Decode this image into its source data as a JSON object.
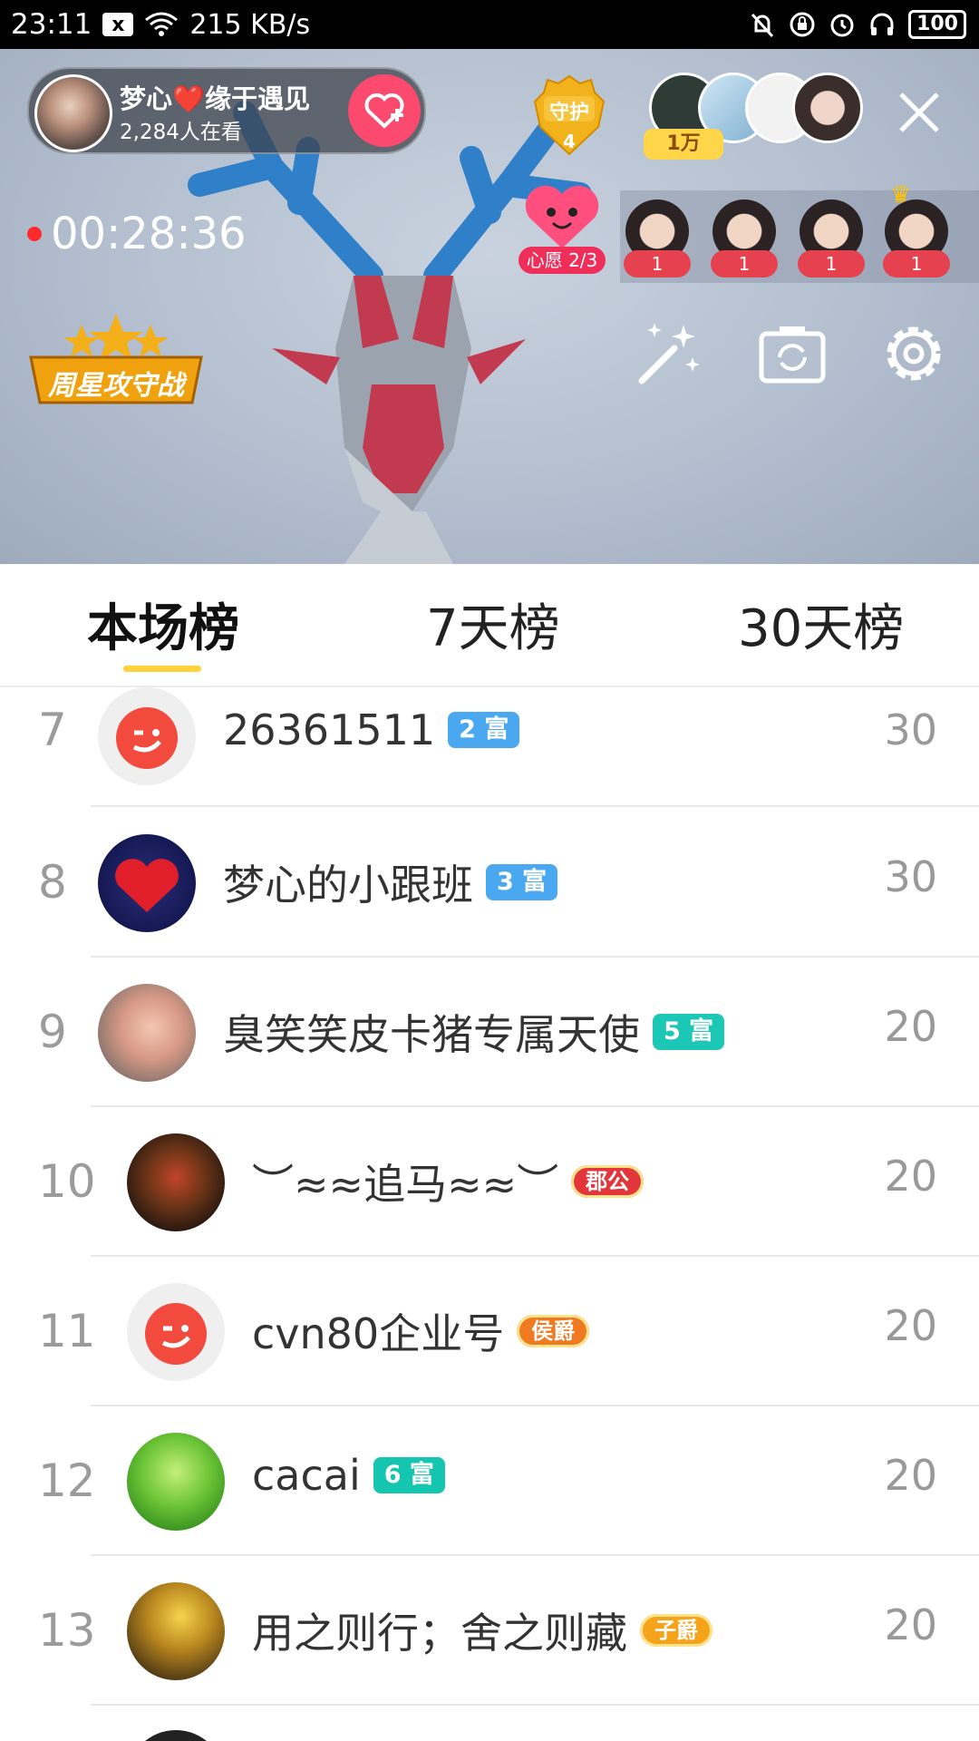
{
  "status_bar": {
    "time": "23:11",
    "net_speed": "215 KB/s",
    "battery": "100",
    "notification_box": "x"
  },
  "live": {
    "host_name": "梦心❤️缘于遇见",
    "viewers": "2,284人在看",
    "guard_label": "守护",
    "guard_count": "4",
    "fan_badge": "1万",
    "timer": "00:28:36",
    "wish_label": "心愿 2/3",
    "week_badge": "周星攻守战",
    "top_counts": [
      "1",
      "1",
      "1",
      "1"
    ]
  },
  "tabs": [
    {
      "label": "本场榜",
      "active": true
    },
    {
      "label": "7天榜",
      "active": false
    },
    {
      "label": "30天榜",
      "active": false
    }
  ],
  "rows": [
    {
      "rank": "7",
      "name": "26361511",
      "badge": "2 富",
      "badge_type": "level",
      "badge_color": "#4aa8f0",
      "score": "30"
    },
    {
      "rank": "8",
      "name": "梦心的小跟班",
      "badge": "3 富",
      "badge_type": "level",
      "badge_color": "#4aa8f0",
      "score": "30"
    },
    {
      "rank": "9",
      "name": "臭笑笑皮卡猪专属天使",
      "badge": "5 富",
      "badge_type": "level",
      "badge_color": "#1cc7b6",
      "score": "20"
    },
    {
      "rank": "10",
      "name": "︶≈≈追马≈≈︶",
      "badge": "郡公",
      "badge_type": "noble",
      "badge_color": "#e2363b",
      "score": "20"
    },
    {
      "rank": "11",
      "name": "cvn80企业号",
      "badge": "侯爵",
      "badge_type": "noble",
      "badge_color": "#f07a21",
      "score": "20"
    },
    {
      "rank": "12",
      "name": "cacai",
      "badge": "6 富",
      "badge_type": "level",
      "badge_color": "#14c5b0",
      "score": "20"
    },
    {
      "rank": "13",
      "name": "用之则行；舍之则藏",
      "badge": "子爵",
      "badge_type": "noble",
      "badge_color": "#f5a31a",
      "score": "20"
    }
  ],
  "colors": {
    "accent_yellow": "#ffd23a",
    "follow_pink": "#fb4a6d",
    "rank_gray": "#9b9b9b"
  }
}
